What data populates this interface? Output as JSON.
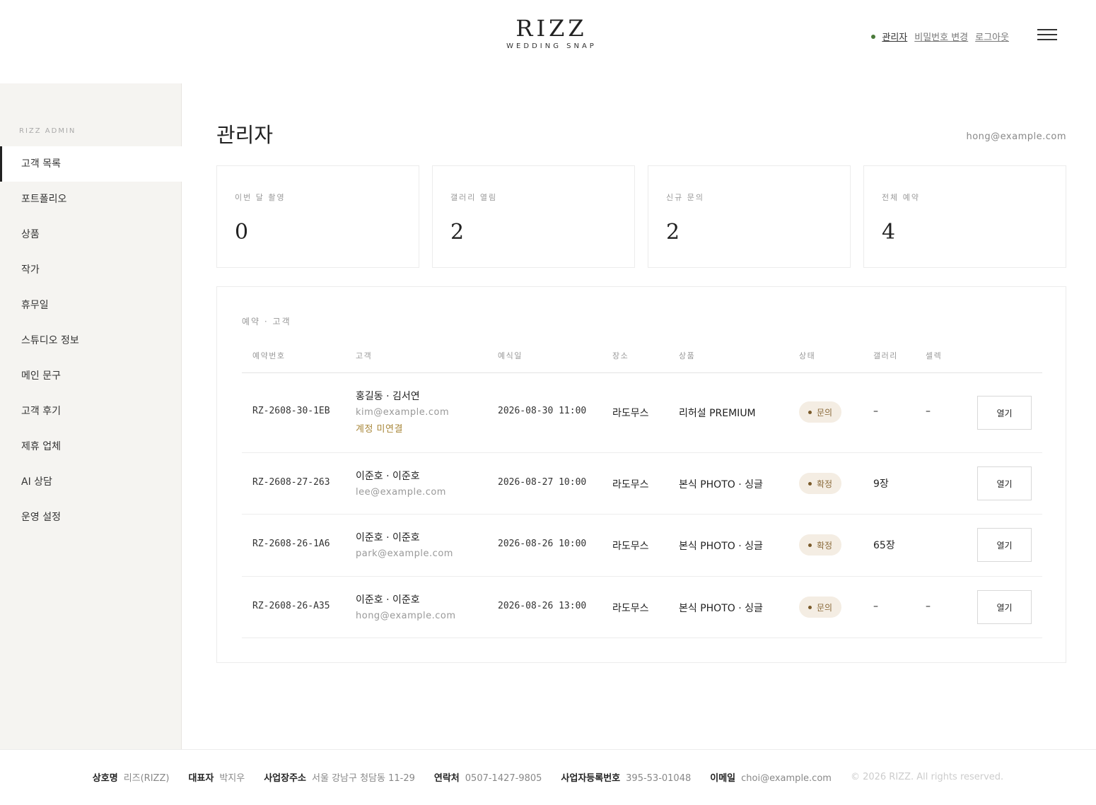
{
  "brand": {
    "name": "RIZZ",
    "tagline": "WEDDING SNAP"
  },
  "top_nav": {
    "admin": "관리자",
    "change_password": "비밀번호 변경",
    "logout": "로그아웃"
  },
  "sidebar": {
    "title": "RIZZ ADMIN",
    "items": [
      {
        "label": "고객 목록",
        "active": true
      },
      {
        "label": "포트폴리오"
      },
      {
        "label": "상품"
      },
      {
        "label": "작가"
      },
      {
        "label": "휴무일"
      },
      {
        "label": "스튜디오 정보"
      },
      {
        "label": "메인 문구"
      },
      {
        "label": "고객 후기"
      },
      {
        "label": "제휴 업체"
      },
      {
        "label": "AI 상담"
      },
      {
        "label": "운영 설정"
      }
    ]
  },
  "main": {
    "title": "관리자",
    "user_email": "hong@example.com"
  },
  "stats": [
    {
      "label": "이번 달 촬영",
      "value": "0"
    },
    {
      "label": "갤러리 열림",
      "value": "2"
    },
    {
      "label": "신규 문의",
      "value": "2"
    },
    {
      "label": "전체 예약",
      "value": "4"
    }
  ],
  "table": {
    "title": "예약 · 고객",
    "headers": {
      "id": "예약번호",
      "customer": "고객",
      "date": "예식일",
      "venue": "장소",
      "product": "상품",
      "status": "상태",
      "gallery": "갤러리",
      "select": "셀렉"
    },
    "rows": [
      {
        "id": "RZ-2608-30-1EB",
        "customer": "홍길동 · 김서연",
        "email": "kim@example.com",
        "flag": "계정 미연결",
        "date": "2026-08-30 11:00",
        "venue": "라도무스",
        "product": "리허설 PREMIUM",
        "status": "문의",
        "gallery": "–",
        "select": "–",
        "action": "열기"
      },
      {
        "id": "RZ-2608-27-263",
        "customer": "이준호 · 이준호",
        "email": "lee@example.com",
        "flag": "",
        "date": "2026-08-27 10:00",
        "venue": "라도무스",
        "product": "본식 PHOTO · 싱글",
        "status": "확정",
        "gallery": "9장",
        "select": "",
        "action": "열기"
      },
      {
        "id": "RZ-2608-26-1A6",
        "customer": "이준호 · 이준호",
        "email": "park@example.com",
        "flag": "",
        "date": "2026-08-26 10:00",
        "venue": "라도무스",
        "product": "본식 PHOTO · 싱글",
        "status": "확정",
        "gallery": "65장",
        "select": "",
        "action": "열기"
      },
      {
        "id": "RZ-2608-26-A35",
        "customer": "이준호 · 이준호",
        "email": "hong@example.com",
        "flag": "",
        "date": "2026-08-26 13:00",
        "venue": "라도무스",
        "product": "본식 PHOTO · 싱글",
        "status": "문의",
        "gallery": "–",
        "select": "–",
        "action": "열기"
      }
    ]
  },
  "footer": {
    "company_label": "상호명",
    "company": "리즈(RIZZ)",
    "ceo_label": "대표자",
    "ceo": "박지우",
    "address_label": "사업장주소",
    "address": "서울 강남구 청담동 11-29",
    "phone_label": "연락처",
    "phone": "0507-1427-9805",
    "bizno_label": "사업자등록번호",
    "bizno": "395-53-01048",
    "email_label": "이메일",
    "email": "choi@example.com",
    "copyright": "© 2026 RIZZ. All rights reserved."
  },
  "colors": {
    "accent": "#a8873a",
    "badge_bg": "#f4ede3",
    "sidebar_bg": "#f5f4f1",
    "nav_dot": "#4a7a3a"
  }
}
